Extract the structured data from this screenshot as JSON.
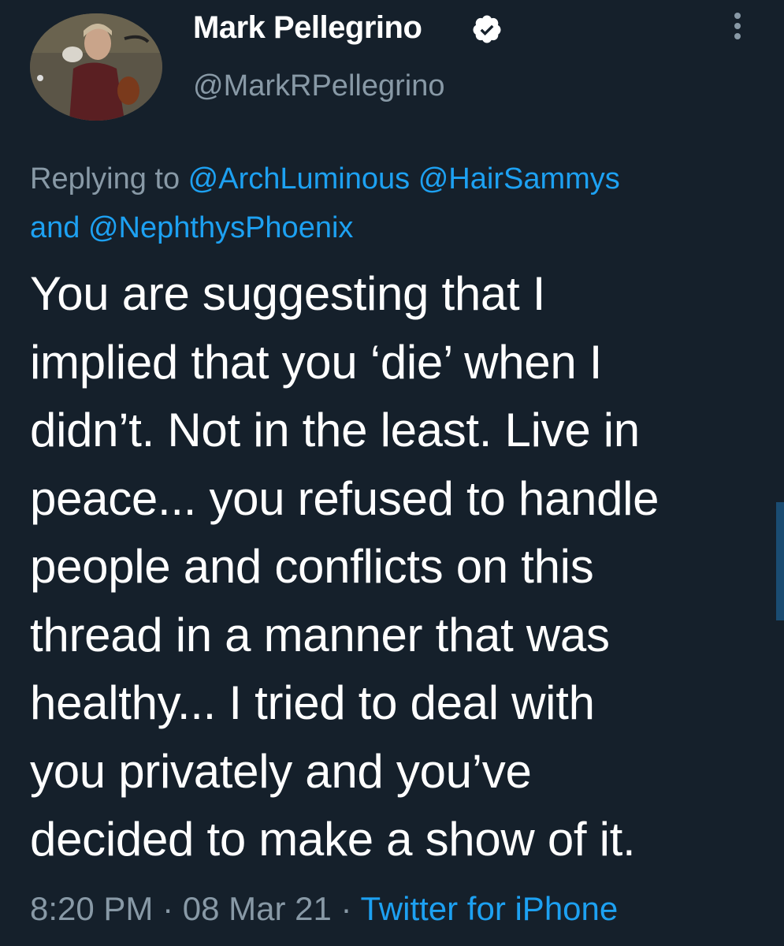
{
  "author": {
    "display_name": "Mark Pellegrino",
    "handle": "@MarkRPellegrino",
    "verified": true,
    "avatar_icon": "profile-avatar-icon",
    "verified_icon": "verified-badge-icon"
  },
  "menu": {
    "icon": "more-vertical-icon"
  },
  "reply": {
    "prefix": "Replying to ",
    "mentions": [
      "@ArchLuminous",
      "@HairSammys",
      "@NephthysPhoenix"
    ],
    "separator_space": " ",
    "separator_and": " and "
  },
  "tweet": {
    "lines": [
      "You are suggesting that I",
      "implied that you ‘die’ when I",
      "didn’t. Not in the least. Live in",
      "peace... you refused to handle",
      "people and conflicts on this",
      "thread in a manner that was",
      "healthy... I tried to deal with",
      "you privately and you’ve",
      "decided to make a show of it."
    ]
  },
  "meta": {
    "time": "8:20 PM",
    "dot": " · ",
    "date": "08 Mar 21",
    "source": "Twitter for iPhone"
  },
  "colors": {
    "background": "#15202b",
    "text": "#ffffff",
    "secondary": "#8899a6",
    "accent": "#1da1f2"
  }
}
